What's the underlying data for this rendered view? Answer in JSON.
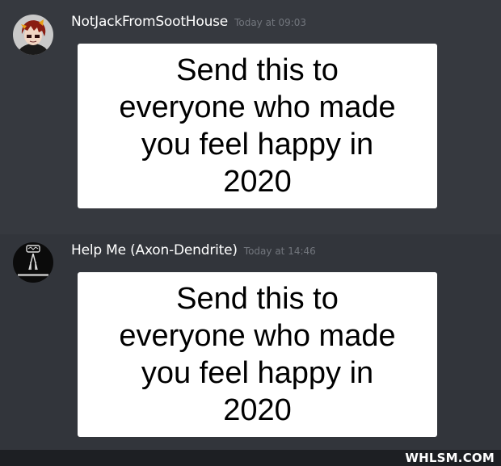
{
  "messages": [
    {
      "author": "NotJackFromSootHouse",
      "timestamp": "Today at 09:03",
      "image_text": [
        "Send this to",
        "everyone who made",
        "you feel happy in",
        "2020"
      ],
      "avatar_icon": "cartoon-red-hair-avatar-icon"
    },
    {
      "author": "Help Me (Axon-Dendrite)",
      "timestamp": "Today at 14:46",
      "image_text": [
        "Send this to",
        "everyone who made",
        "you feel happy in",
        "2020"
      ],
      "avatar_icon": "dark-logo-avatar-icon"
    }
  ],
  "watermark": "WHLSM.COM",
  "colors": {
    "background": "#36393f",
    "username": "#ffffff",
    "timestamp": "#72767d",
    "footer": "#1d1f23"
  }
}
